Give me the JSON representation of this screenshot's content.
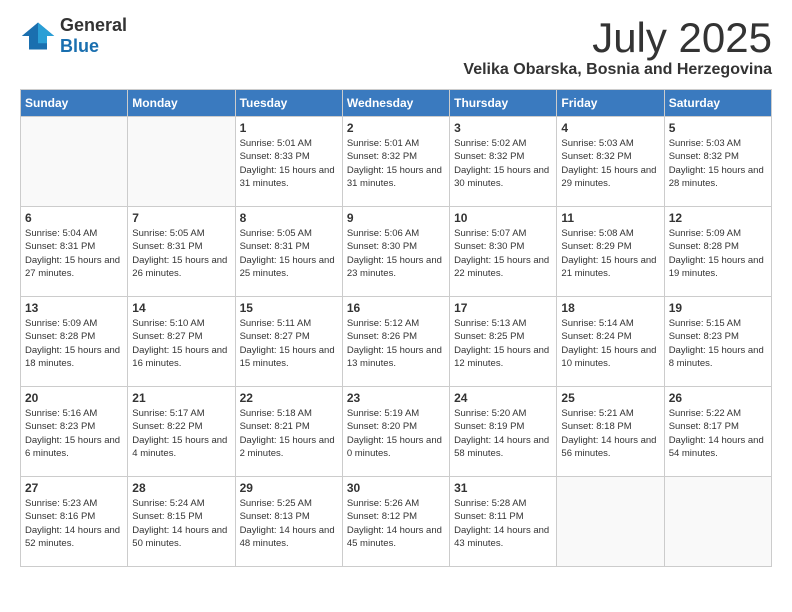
{
  "header": {
    "logo_general": "General",
    "logo_blue": "Blue",
    "month_title": "July 2025",
    "location": "Velika Obarska, Bosnia and Herzegovina"
  },
  "days_of_week": [
    "Sunday",
    "Monday",
    "Tuesday",
    "Wednesday",
    "Thursday",
    "Friday",
    "Saturday"
  ],
  "weeks": [
    [
      {
        "day": "",
        "empty": true
      },
      {
        "day": "",
        "empty": true
      },
      {
        "day": "1",
        "sunrise": "Sunrise: 5:01 AM",
        "sunset": "Sunset: 8:33 PM",
        "daylight": "Daylight: 15 hours and 31 minutes."
      },
      {
        "day": "2",
        "sunrise": "Sunrise: 5:01 AM",
        "sunset": "Sunset: 8:32 PM",
        "daylight": "Daylight: 15 hours and 31 minutes."
      },
      {
        "day": "3",
        "sunrise": "Sunrise: 5:02 AM",
        "sunset": "Sunset: 8:32 PM",
        "daylight": "Daylight: 15 hours and 30 minutes."
      },
      {
        "day": "4",
        "sunrise": "Sunrise: 5:03 AM",
        "sunset": "Sunset: 8:32 PM",
        "daylight": "Daylight: 15 hours and 29 minutes."
      },
      {
        "day": "5",
        "sunrise": "Sunrise: 5:03 AM",
        "sunset": "Sunset: 8:32 PM",
        "daylight": "Daylight: 15 hours and 28 minutes."
      }
    ],
    [
      {
        "day": "6",
        "sunrise": "Sunrise: 5:04 AM",
        "sunset": "Sunset: 8:31 PM",
        "daylight": "Daylight: 15 hours and 27 minutes."
      },
      {
        "day": "7",
        "sunrise": "Sunrise: 5:05 AM",
        "sunset": "Sunset: 8:31 PM",
        "daylight": "Daylight: 15 hours and 26 minutes."
      },
      {
        "day": "8",
        "sunrise": "Sunrise: 5:05 AM",
        "sunset": "Sunset: 8:31 PM",
        "daylight": "Daylight: 15 hours and 25 minutes."
      },
      {
        "day": "9",
        "sunrise": "Sunrise: 5:06 AM",
        "sunset": "Sunset: 8:30 PM",
        "daylight": "Daylight: 15 hours and 23 minutes."
      },
      {
        "day": "10",
        "sunrise": "Sunrise: 5:07 AM",
        "sunset": "Sunset: 8:30 PM",
        "daylight": "Daylight: 15 hours and 22 minutes."
      },
      {
        "day": "11",
        "sunrise": "Sunrise: 5:08 AM",
        "sunset": "Sunset: 8:29 PM",
        "daylight": "Daylight: 15 hours and 21 minutes."
      },
      {
        "day": "12",
        "sunrise": "Sunrise: 5:09 AM",
        "sunset": "Sunset: 8:28 PM",
        "daylight": "Daylight: 15 hours and 19 minutes."
      }
    ],
    [
      {
        "day": "13",
        "sunrise": "Sunrise: 5:09 AM",
        "sunset": "Sunset: 8:28 PM",
        "daylight": "Daylight: 15 hours and 18 minutes."
      },
      {
        "day": "14",
        "sunrise": "Sunrise: 5:10 AM",
        "sunset": "Sunset: 8:27 PM",
        "daylight": "Daylight: 15 hours and 16 minutes."
      },
      {
        "day": "15",
        "sunrise": "Sunrise: 5:11 AM",
        "sunset": "Sunset: 8:27 PM",
        "daylight": "Daylight: 15 hours and 15 minutes."
      },
      {
        "day": "16",
        "sunrise": "Sunrise: 5:12 AM",
        "sunset": "Sunset: 8:26 PM",
        "daylight": "Daylight: 15 hours and 13 minutes."
      },
      {
        "day": "17",
        "sunrise": "Sunrise: 5:13 AM",
        "sunset": "Sunset: 8:25 PM",
        "daylight": "Daylight: 15 hours and 12 minutes."
      },
      {
        "day": "18",
        "sunrise": "Sunrise: 5:14 AM",
        "sunset": "Sunset: 8:24 PM",
        "daylight": "Daylight: 15 hours and 10 minutes."
      },
      {
        "day": "19",
        "sunrise": "Sunrise: 5:15 AM",
        "sunset": "Sunset: 8:23 PM",
        "daylight": "Daylight: 15 hours and 8 minutes."
      }
    ],
    [
      {
        "day": "20",
        "sunrise": "Sunrise: 5:16 AM",
        "sunset": "Sunset: 8:23 PM",
        "daylight": "Daylight: 15 hours and 6 minutes."
      },
      {
        "day": "21",
        "sunrise": "Sunrise: 5:17 AM",
        "sunset": "Sunset: 8:22 PM",
        "daylight": "Daylight: 15 hours and 4 minutes."
      },
      {
        "day": "22",
        "sunrise": "Sunrise: 5:18 AM",
        "sunset": "Sunset: 8:21 PM",
        "daylight": "Daylight: 15 hours and 2 minutes."
      },
      {
        "day": "23",
        "sunrise": "Sunrise: 5:19 AM",
        "sunset": "Sunset: 8:20 PM",
        "daylight": "Daylight: 15 hours and 0 minutes."
      },
      {
        "day": "24",
        "sunrise": "Sunrise: 5:20 AM",
        "sunset": "Sunset: 8:19 PM",
        "daylight": "Daylight: 14 hours and 58 minutes."
      },
      {
        "day": "25",
        "sunrise": "Sunrise: 5:21 AM",
        "sunset": "Sunset: 8:18 PM",
        "daylight": "Daylight: 14 hours and 56 minutes."
      },
      {
        "day": "26",
        "sunrise": "Sunrise: 5:22 AM",
        "sunset": "Sunset: 8:17 PM",
        "daylight": "Daylight: 14 hours and 54 minutes."
      }
    ],
    [
      {
        "day": "27",
        "sunrise": "Sunrise: 5:23 AM",
        "sunset": "Sunset: 8:16 PM",
        "daylight": "Daylight: 14 hours and 52 minutes."
      },
      {
        "day": "28",
        "sunrise": "Sunrise: 5:24 AM",
        "sunset": "Sunset: 8:15 PM",
        "daylight": "Daylight: 14 hours and 50 minutes."
      },
      {
        "day": "29",
        "sunrise": "Sunrise: 5:25 AM",
        "sunset": "Sunset: 8:13 PM",
        "daylight": "Daylight: 14 hours and 48 minutes."
      },
      {
        "day": "30",
        "sunrise": "Sunrise: 5:26 AM",
        "sunset": "Sunset: 8:12 PM",
        "daylight": "Daylight: 14 hours and 45 minutes."
      },
      {
        "day": "31",
        "sunrise": "Sunrise: 5:28 AM",
        "sunset": "Sunset: 8:11 PM",
        "daylight": "Daylight: 14 hours and 43 minutes."
      },
      {
        "day": "",
        "empty": true
      },
      {
        "day": "",
        "empty": true
      }
    ]
  ]
}
